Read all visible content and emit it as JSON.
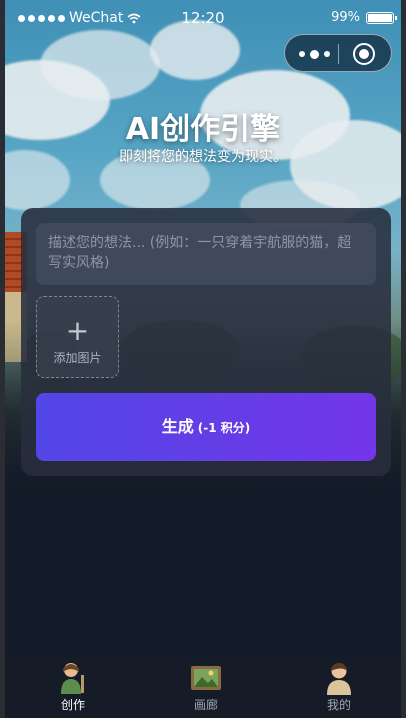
{
  "status_bar": {
    "carrier": "WeChat",
    "time": "12:20",
    "battery": "99%",
    "battery_level": 0.99
  },
  "capsule": {
    "more_icon": "more-dots-icon",
    "close_icon": "target-circle-icon"
  },
  "hero": {
    "title": "AI创作引擎",
    "subtitle": "即刻将您的想法变为现实。"
  },
  "form": {
    "prompt_placeholder": "描述您的想法... (例如：一只穿着宇航服的猫，超写实风格)",
    "prompt_value": "",
    "upload_icon": "plus-icon",
    "upload_label": "添加图片",
    "generate_label": "生成",
    "generate_cost": "(-1 积分)"
  },
  "tabbar": {
    "items": [
      {
        "label": "创作",
        "icon": "creator-avatar-icon",
        "active": true
      },
      {
        "label": "画廊",
        "icon": "picture-frame-icon",
        "active": false
      },
      {
        "label": "我的",
        "icon": "user-avatar-icon",
        "active": false
      }
    ]
  },
  "colors": {
    "accent_start": "#5246e6",
    "accent_end": "#7336e8",
    "background": "#131a28",
    "card": "#282e3e"
  }
}
